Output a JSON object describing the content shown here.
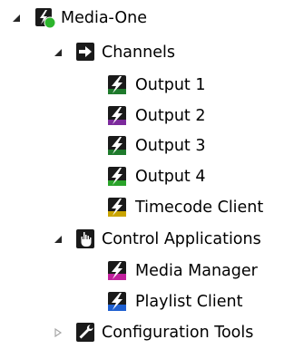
{
  "tree": {
    "root": {
      "label": "Media-One",
      "icon": "media-one-server-icon",
      "expanded": true,
      "status_color": "#2db52d"
    },
    "channels": {
      "label": "Channels",
      "icon": "channels-arrow-icon",
      "expanded": true,
      "items": [
        {
          "label": "Output 1",
          "icon": "output-bolt-icon",
          "accent": "#1f7a2c"
        },
        {
          "label": "Output 2",
          "icon": "output-bolt-icon",
          "accent": "#7c2a9c"
        },
        {
          "label": "Output 3",
          "icon": "output-bolt-icon",
          "accent": "#1f7a2c"
        },
        {
          "label": "Output 4",
          "icon": "output-bolt-icon",
          "accent": "#2aa32a"
        },
        {
          "label": "Timecode Client",
          "icon": "timecode-bolt-icon",
          "accent": "#c9a400"
        }
      ]
    },
    "control_applications": {
      "label": "Control Applications",
      "icon": "hand-pointer-icon",
      "expanded": true,
      "items": [
        {
          "label": "Media Manager",
          "icon": "media-manager-bolt-icon",
          "accent": "#c0209c"
        },
        {
          "label": "Playlist Client",
          "icon": "playlist-bolt-icon",
          "accent": "#1e5fd0"
        }
      ]
    },
    "configuration_tools": {
      "label": "Configuration Tools",
      "icon": "wrench-icon",
      "expanded": false
    }
  },
  "colors": {
    "expander_expanded": "#262626",
    "expander_collapsed": "#a6a6a6",
    "icon_dark": "#1a1a1a",
    "icon_light": "#ffffff"
  }
}
